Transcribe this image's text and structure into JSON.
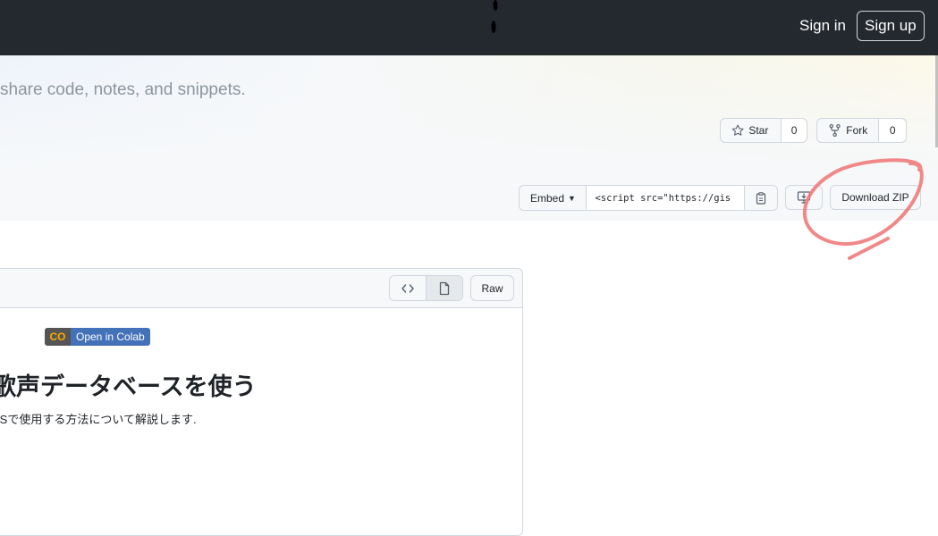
{
  "header": {
    "sign_in": "Sign in",
    "sign_up": "Sign up"
  },
  "hero": {
    "tagline": "share code, notes, and snippets."
  },
  "actions": {
    "star_label": "Star",
    "star_count": "0",
    "fork_label": "Fork",
    "fork_count": "0",
    "embed_label": "Embed",
    "embed_value": "<script src=\"https://gis",
    "download_zip": "Download ZIP"
  },
  "file": {
    "raw_label": "Raw",
    "colab_badge": "Open in Colab",
    "colab_logo": "CO",
    "heading": "歌声データベースを使う",
    "paragraph": "VSで使用する方法について解説します."
  },
  "colors": {
    "topbar": "#24292f",
    "annotation": "#f07b7b",
    "colab_blue": "#4472b8",
    "colab_logo": "#f9ab00"
  }
}
